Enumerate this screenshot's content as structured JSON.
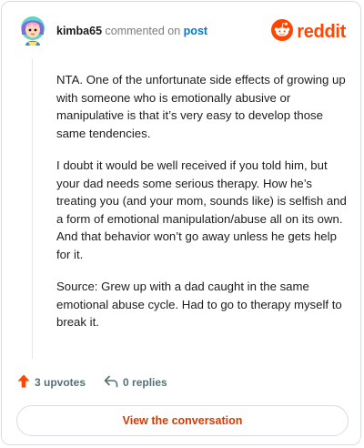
{
  "comment": {
    "username": "kimba65",
    "action_text": " commented on ",
    "post_link": "post",
    "paragraphs": [
      "NTA. One of the unfortunate side effects of growing up with someone who is emotionally abusive or manipulative is that it’s very easy to develop those same tendencies.",
      "I doubt it would be well received if you told him, but your dad needs some serious therapy. How he’s treating you (and your mom, sounds like) is selfish and a form of emotional manipulation/abuse all on its own. And that behavior won’t go away unless he gets help for it.",
      "Source: Grew up with a dad caught in the same emotional abuse cycle. Had to go to therapy myself to break it."
    ],
    "upvotes": "3 upvotes",
    "replies": "0 replies"
  },
  "brand": {
    "wordmark": "reddit",
    "icon": "reddit-snoo-icon",
    "color": "#ff4500"
  },
  "avatar": {
    "icon": "user-avatar-icon"
  },
  "footer": {
    "view_button": "View the conversation",
    "upvote_icon": "upvote-arrow-icon",
    "reply_icon": "reply-arrow-icon",
    "upvote_color": "#ff4500"
  }
}
